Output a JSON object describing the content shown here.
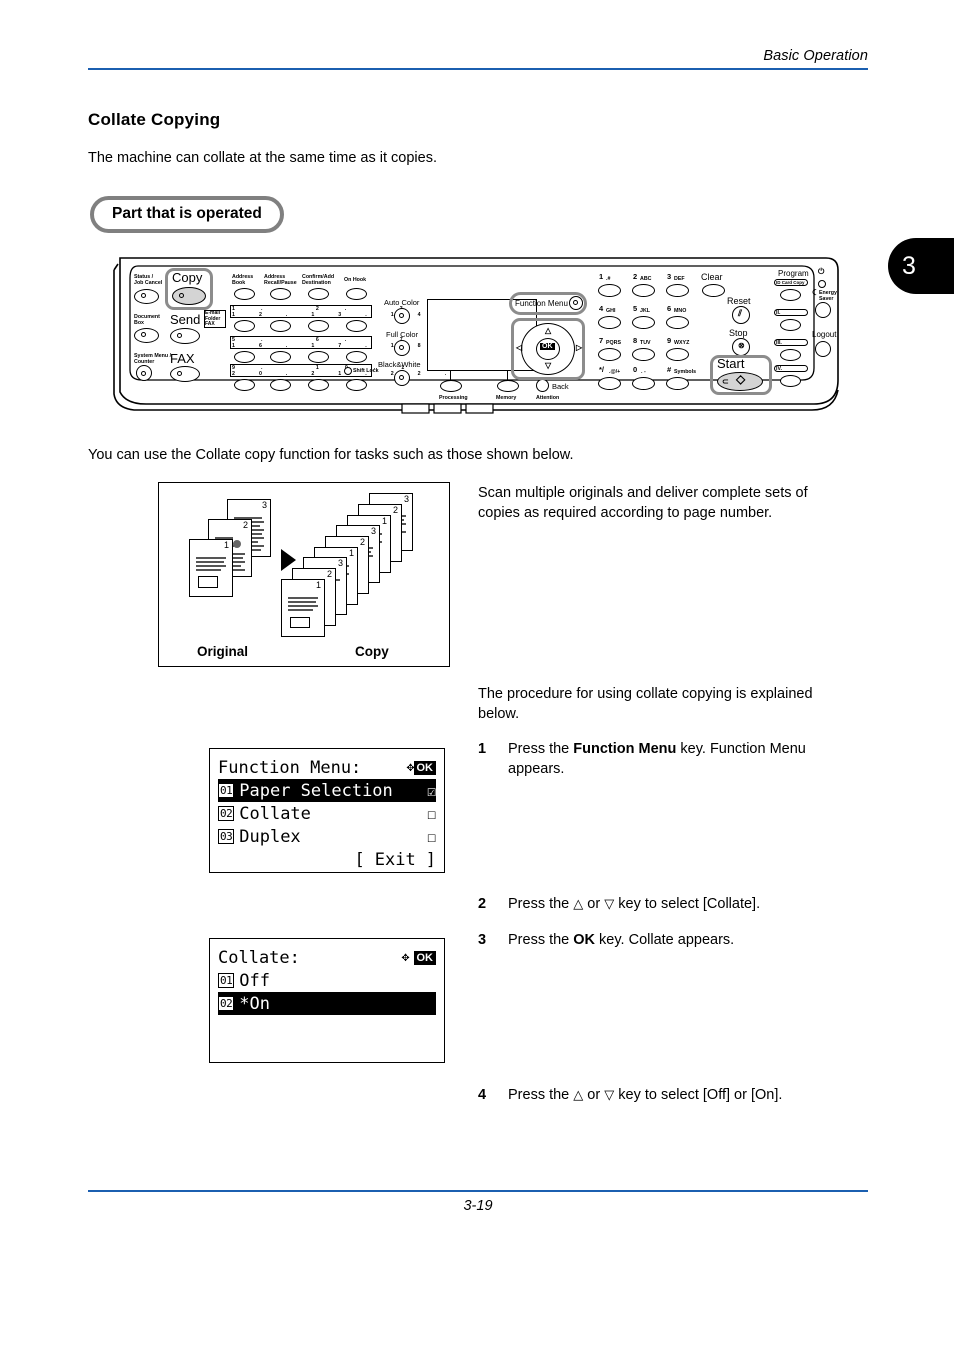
{
  "header": {
    "title": "Basic Operation",
    "rule_color": "#1b5fb0"
  },
  "footer": {
    "page_number": "3-19",
    "rule_color": "#1b5fb0"
  },
  "page_tab": {
    "chapter": "3"
  },
  "section": {
    "heading": "Collate Copying",
    "intro": "The machine can collate at the same time as it copies.",
    "callout_label": "Part that is operated",
    "lead_text": "You can use the Collate copy function for tasks such as those shown below.",
    "description": "Scan multiple originals and deliver complete sets of copies as required according to page number.",
    "procedure_intro": "The procedure for using collate copying is explained below."
  },
  "illustration": {
    "original_label": "Original",
    "copy_label": "Copy",
    "page_numbers": [
      "1",
      "2",
      "3"
    ]
  },
  "steps": [
    {
      "num": "1",
      "text_pre": "Press the ",
      "bold": "Function Menu",
      "text_post": " key. Function Menu appears."
    },
    {
      "num": "2",
      "text_pre": "Press the ",
      "sym_up": "△",
      "mid": " or ",
      "sym_dn": "▽",
      "text_post": " key to select [Collate]."
    },
    {
      "num": "3",
      "text_pre": "Press the ",
      "bold": "OK",
      "text_post": " key. Collate appears."
    },
    {
      "num": "4",
      "text_pre": "Press the ",
      "sym_up": "△",
      "mid": " or ",
      "sym_dn": "▽",
      "text_post": " key to select [Off] or [On]."
    }
  ],
  "lcd_function_menu": {
    "title": "Function Menu:",
    "ok_badge": "OK",
    "nav_arrows": "✥",
    "rows": [
      {
        "index": "01",
        "label": "Paper Selection",
        "marker": "☑",
        "selected": true
      },
      {
        "index": "02",
        "label": "Collate",
        "marker": "☐",
        "selected": false
      },
      {
        "index": "03",
        "label": "Duplex",
        "marker": "☐",
        "selected": false
      }
    ],
    "footer_left": "[",
    "footer_label": "Exit",
    "footer_right": "]"
  },
  "lcd_collate": {
    "title": "Collate:",
    "ok_badge": "OK",
    "nav_arrows": "✥",
    "rows": [
      {
        "index": "01",
        "label": "Off",
        "selected": false
      },
      {
        "index": "02",
        "label": "*On",
        "selected": true
      }
    ]
  },
  "control_panel": {
    "keys_left": [
      {
        "name": "status-job-cancel",
        "label": "Status /\nJob Cancel"
      },
      {
        "name": "document-box",
        "label": "Document\nBox"
      },
      {
        "name": "system-menu-counter",
        "label": "System Menu /\nCounter"
      }
    ],
    "mode_keys": [
      {
        "name": "copy",
        "label": "Copy",
        "highlighted": true
      },
      {
        "name": "send",
        "label": "Send"
      },
      {
        "name": "fax",
        "label": "FAX"
      }
    ],
    "send_tag": "E-mail\nFolder\nFAX",
    "addr_keys": [
      {
        "label": "Address\nBook"
      },
      {
        "label": "Address\nRecall/Pause"
      },
      {
        "label": "Confirm/Add\nDestination"
      },
      {
        "label": "On Hook"
      }
    ],
    "color_keys": [
      "Auto Color",
      "Full Color",
      "Black&White"
    ],
    "shift_lock": "Shift Lock",
    "indicators": [
      "Processing",
      "Memory",
      "Attention"
    ],
    "back_key": "Back",
    "function_menu_key": "Function Menu",
    "ok_key": "OK",
    "numeric_keys": [
      "1 .#",
      "2 ABC",
      "3 DEF",
      "4 GHI",
      "5 JKL",
      "6 MNO",
      "7 PQRS",
      "8 TUV",
      "9 WXYZ",
      "*/ .@/+",
      "0 . -",
      "# Symbols"
    ],
    "clear_key": "Clear",
    "reset_key": "Reset",
    "stop_key": "Stop",
    "start_key": "Start",
    "program_key": "Program",
    "program_sub": "ID Card Copy",
    "energy_saver": "Energy\nSaver",
    "logout_key": "Logout",
    "highlight_color": "#8c8c8c",
    "copy_fill": "#d4d4d4"
  }
}
